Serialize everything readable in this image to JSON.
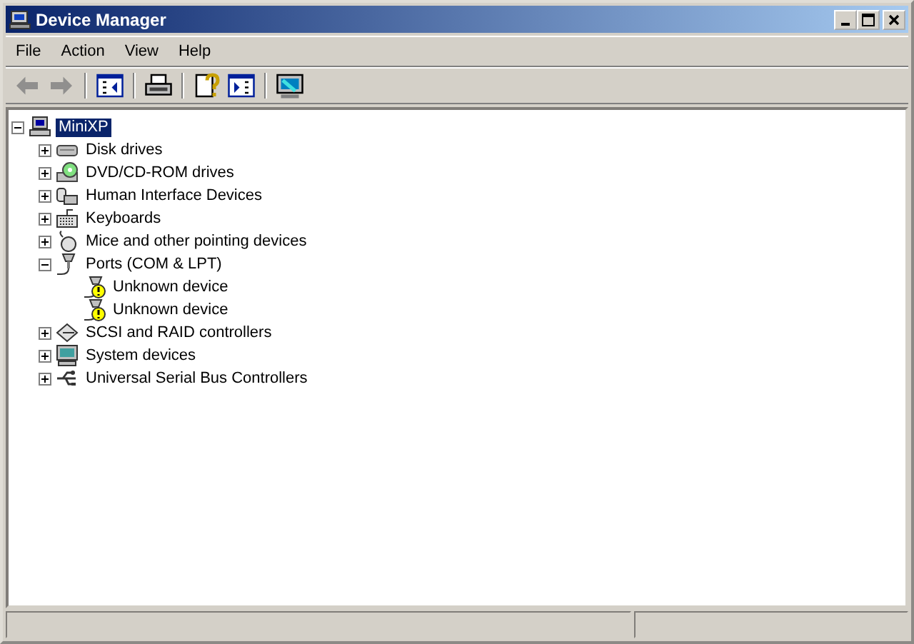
{
  "window": {
    "title": "Device Manager"
  },
  "menu": [
    "File",
    "Action",
    "View",
    "Help"
  ],
  "toolbar": [
    {
      "kind": "back",
      "disabled": true
    },
    {
      "kind": "forward",
      "disabled": true
    },
    {
      "kind": "sep"
    },
    {
      "kind": "tree",
      "disabled": false
    },
    {
      "kind": "sep"
    },
    {
      "kind": "print",
      "disabled": false
    },
    {
      "kind": "sep"
    },
    {
      "kind": "properties",
      "disabled": false
    },
    {
      "kind": "pane",
      "disabled": false
    },
    {
      "kind": "sep"
    },
    {
      "kind": "scan",
      "disabled": false
    }
  ],
  "tree": [
    {
      "label": "MiniXP",
      "kind": "computer",
      "selected": true,
      "expanded": true,
      "children": [
        {
          "label": "Disk drives",
          "kind": "disk",
          "selected": false,
          "expanded": false
        },
        {
          "label": "DVD/CD-ROM drives",
          "kind": "dvd",
          "selected": false,
          "expanded": false
        },
        {
          "label": "Human Interface Devices",
          "kind": "hid",
          "selected": false,
          "expanded": false
        },
        {
          "label": "Keyboards",
          "kind": "keyboard",
          "selected": false,
          "expanded": false
        },
        {
          "label": "Mice and other pointing devices",
          "kind": "mouse",
          "selected": false,
          "expanded": false
        },
        {
          "label": "Ports (COM & LPT)",
          "kind": "port",
          "selected": false,
          "expanded": true,
          "children": [
            {
              "label": "Unknown device",
              "kind": "port",
              "selected": false,
              "problem": true
            },
            {
              "label": "Unknown device",
              "kind": "port",
              "selected": false,
              "problem": true
            }
          ]
        },
        {
          "label": "SCSI and RAID controllers",
          "kind": "scsi",
          "selected": false,
          "expanded": false
        },
        {
          "label": "System devices",
          "kind": "system",
          "selected": false,
          "expanded": false
        },
        {
          "label": "Universal Serial Bus Controllers",
          "kind": "usb",
          "selected": false,
          "expanded": false
        }
      ]
    }
  ]
}
